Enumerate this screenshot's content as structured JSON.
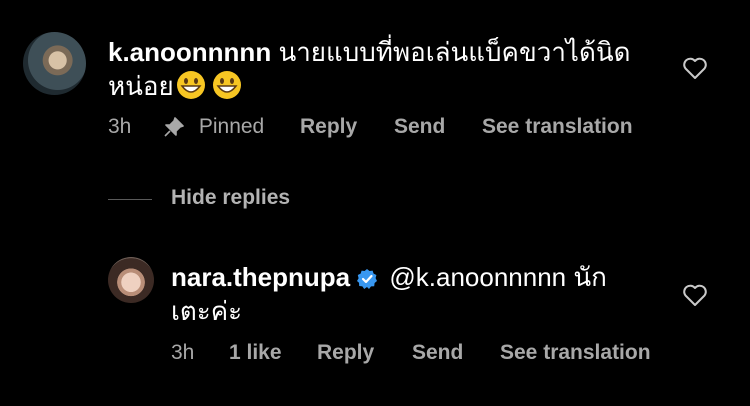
{
  "comment1": {
    "username": "k.anoonnnnn",
    "text_line1": "นายแบบที่พอเล่นแบ็คขวาได้นิด",
    "text_line2": "หน่อย",
    "time": "3h",
    "pinned_label": "Pinned",
    "reply_label": "Reply",
    "send_label": "Send",
    "translate_label": "See translation"
  },
  "thread": {
    "hide_replies_label": "Hide replies"
  },
  "reply1": {
    "username": "nara.thepnupa",
    "mention": "@k.anoonnnnn",
    "text_line1": "นัก",
    "text_line2": "เตะค่ะ",
    "time": "3h",
    "likes_label": "1 like",
    "reply_label": "Reply",
    "send_label": "Send",
    "translate_label": "See translation"
  },
  "icons": {
    "heart": "heart-icon",
    "pin": "pin-icon",
    "verified": "verified-badge-icon",
    "emoji": "grinning-face-emoji"
  },
  "colors": {
    "background": "#000000",
    "text": "#ffffff",
    "muted": "#a8a8a8",
    "verified_blue": "#3897f0",
    "emoji_yellow": "#f7c623"
  }
}
